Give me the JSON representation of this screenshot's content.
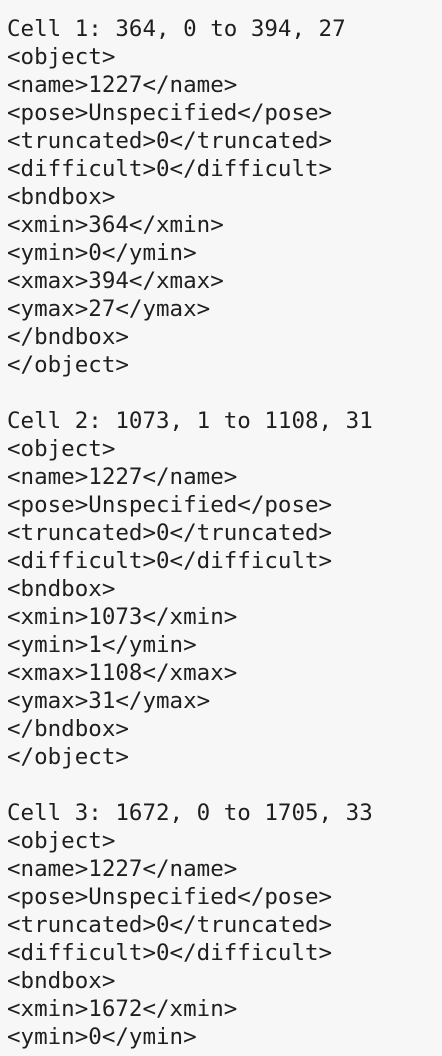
{
  "lines": [
    "Cell 1: 364, 0 to 394, 27",
    "<object>",
    "<name>1227</name>",
    "<pose>Unspecified</pose>",
    "<truncated>0</truncated>",
    "<difficult>0</difficult>",
    "<bndbox>",
    "<xmin>364</xmin>",
    "<ymin>0</ymin>",
    "<xmax>394</xmax>",
    "<ymax>27</ymax>",
    "</bndbox>",
    "</object>",
    "",
    "Cell 2: 1073, 1 to 1108, 31",
    "<object>",
    "<name>1227</name>",
    "<pose>Unspecified</pose>",
    "<truncated>0</truncated>",
    "<difficult>0</difficult>",
    "<bndbox>",
    "<xmin>1073</xmin>",
    "<ymin>1</ymin>",
    "<xmax>1108</xmax>",
    "<ymax>31</ymax>",
    "</bndbox>",
    "</object>",
    "",
    "Cell 3: 1672, 0 to 1705, 33",
    "<object>",
    "<name>1227</name>",
    "<pose>Unspecified</pose>",
    "<truncated>0</truncated>",
    "<difficult>0</difficult>",
    "<bndbox>",
    "<xmin>1672</xmin>",
    "<ymin>0</ymin>"
  ]
}
